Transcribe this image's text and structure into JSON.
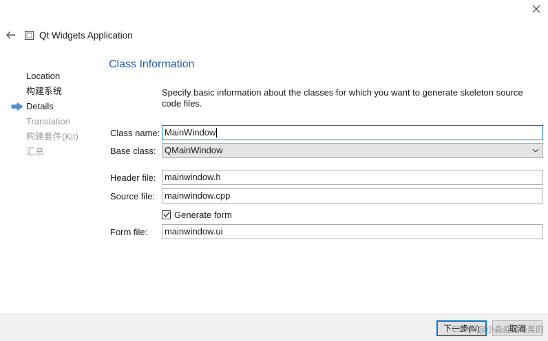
{
  "window": {
    "title": "Qt Widgets Application"
  },
  "steps": [
    {
      "label": "Location",
      "state": "done"
    },
    {
      "label": "构建系统",
      "state": "done"
    },
    {
      "label": "Details",
      "state": "current"
    },
    {
      "label": "Translation",
      "state": "future"
    },
    {
      "label": "构建套件(Kit)",
      "state": "future"
    },
    {
      "label": "汇总",
      "state": "future"
    }
  ],
  "page": {
    "title": "Class Information",
    "description": "Specify basic information about the classes for which you want to generate skeleton source code files."
  },
  "form": {
    "class_name": {
      "label": "Class name:",
      "value": "MainWindow"
    },
    "base_class": {
      "label": "Base class:",
      "value": "QMainWindow"
    },
    "header_file": {
      "label": "Header file:",
      "value": "mainwindow.h"
    },
    "source_file": {
      "label": "Source file:",
      "value": "mainwindow.cpp"
    },
    "generate_form": {
      "label": "Generate form",
      "checked": true
    },
    "form_file": {
      "label": "Form file:",
      "value": "mainwindow.ui"
    }
  },
  "footer": {
    "next_label": "下一步(N)",
    "cancel_label": "取消"
  },
  "watermark": "CSDN @小淼淼是最美的",
  "colors": {
    "accent": "#0078d7",
    "title": "#2f5d9e",
    "current_marker": "#4a90d9"
  }
}
